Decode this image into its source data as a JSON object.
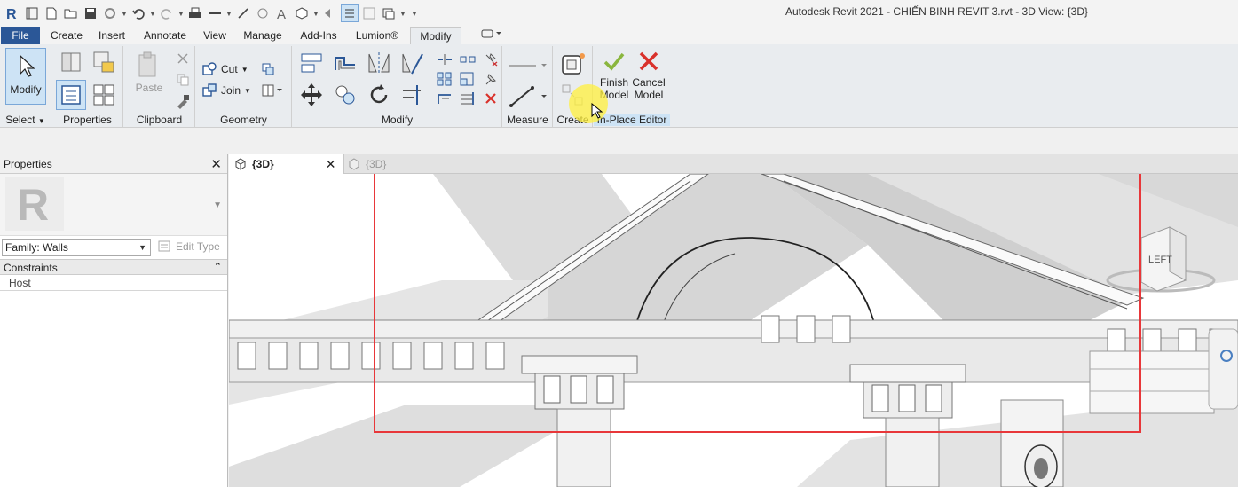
{
  "window": {
    "title": "Autodesk Revit 2021 - CHIẾN BINH REVIT 3.rvt - 3D View: {3D}"
  },
  "ribbon_tabs": [
    "File",
    "Create",
    "Insert",
    "Annotate",
    "View",
    "Manage",
    "Add-Ins",
    "Lumion®",
    "Modify"
  ],
  "panels": {
    "select": {
      "button": "Modify",
      "label": "Select"
    },
    "properties": {
      "label": "Properties"
    },
    "clipboard": {
      "paste": "Paste",
      "label": "Clipboard"
    },
    "geometry": {
      "cut": "Cut",
      "join": "Join",
      "label": "Geometry"
    },
    "modify": {
      "label": "Modify"
    },
    "measure": {
      "label": "Measure"
    },
    "create": {
      "label": "Create"
    },
    "inplace": {
      "finish_1": "Finish",
      "finish_2": "Model",
      "cancel_1": "Cancel",
      "cancel_2": "Model",
      "label": "In-Place Editor"
    }
  },
  "properties_palette": {
    "title": "Properties",
    "family": "Family: Walls",
    "edit_type": "Edit Type",
    "constraints": "Constraints",
    "host_label": "Host",
    "host_value": ""
  },
  "view_tabs": [
    {
      "label": "{3D}",
      "active": true
    },
    {
      "label": "{3D}",
      "active": false
    }
  ],
  "viewcube": {
    "face": "LEFT"
  },
  "colors": {
    "file_tab": "#2b5797",
    "highlight_box": "#e8373a",
    "cursor_halo": "#fff03c",
    "finish_check": "#8ab63e",
    "cancel_x": "#d9312b"
  }
}
